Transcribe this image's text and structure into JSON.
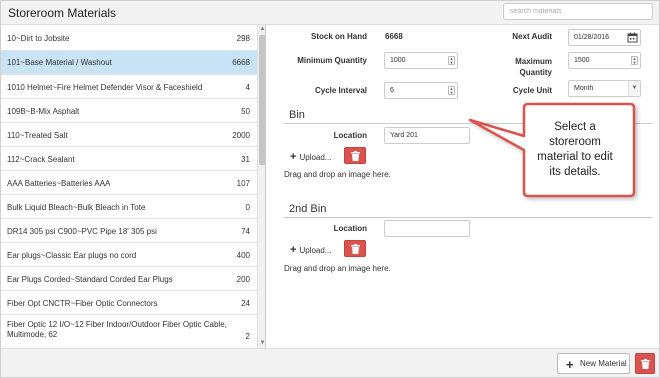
{
  "header": {
    "title": "Storeroom Materials",
    "search_placeholder": "search materials"
  },
  "materials": [
    {
      "label": "10~Dirt to Jobsite",
      "count": "298",
      "selected": false
    },
    {
      "label": "101~Base Material / Washout",
      "count": "6668",
      "selected": true
    },
    {
      "label": "1010 Helmet~Fire Helmet Defender Visor & Faceshield",
      "count": "4",
      "selected": false
    },
    {
      "label": "109B~B-Mix Asphalt",
      "count": "50",
      "selected": false
    },
    {
      "label": "110~Treated Salt",
      "count": "2000",
      "selected": false
    },
    {
      "label": "112~Crack Sealant",
      "count": "31",
      "selected": false
    },
    {
      "label": "AAA Batteries~Batteries AAA",
      "count": "107",
      "selected": false
    },
    {
      "label": "Bulk Liquid Bleach~Bulk Bleach in Tote",
      "count": "0",
      "selected": false
    },
    {
      "label": "DR14 305 psi C900~PVC Pipe 18' 305 psi",
      "count": "74",
      "selected": false
    },
    {
      "label": "Ear plugs~Classic Ear plugs no cord",
      "count": "400",
      "selected": false
    },
    {
      "label": "Ear Plugs Corded~Standard Corded Ear Plugs",
      "count": "200",
      "selected": false
    },
    {
      "label": "Fiber Opt CNCTR~Fiber Optic Connectors",
      "count": "24",
      "selected": false
    },
    {
      "label": "Fiber Optic 12 I/O~12 Fiber Indoor/Outdoor Fiber Optic Cable, Multimode, 62",
      "count": "2",
      "selected": false
    }
  ],
  "detail": {
    "stock_label": "Stock on Hand",
    "stock_value": "6668",
    "next_audit_label": "Next Audit",
    "next_audit_value": "01/28/2016",
    "min_qty_label": "Minimum Quantity",
    "min_qty_value": "1000",
    "max_qty_label": "Maximum Quantity",
    "max_qty_value": "1500",
    "cycle_interval_label": "Cycle Interval",
    "cycle_interval_value": "6",
    "cycle_unit_label": "Cycle Unit",
    "cycle_unit_value": "Month"
  },
  "bin": {
    "title": "Bin",
    "location_label": "Location",
    "location_value": "Yard 201",
    "upload_label": "Upload...",
    "drag_hint": "Drag and drop an image here."
  },
  "bin2": {
    "title": "2nd Bin",
    "location_label": "Location",
    "location_value": "",
    "upload_label": "Upload...",
    "drag_hint": "Drag and drop an image here."
  },
  "callout": {
    "text": "Select a storeroom material to edit its details."
  },
  "footer": {
    "new_material_label": "New Material"
  },
  "colors": {
    "selected_row": "#c8e3f5",
    "danger": "#d9534f",
    "callout_border": "#d9534f"
  }
}
